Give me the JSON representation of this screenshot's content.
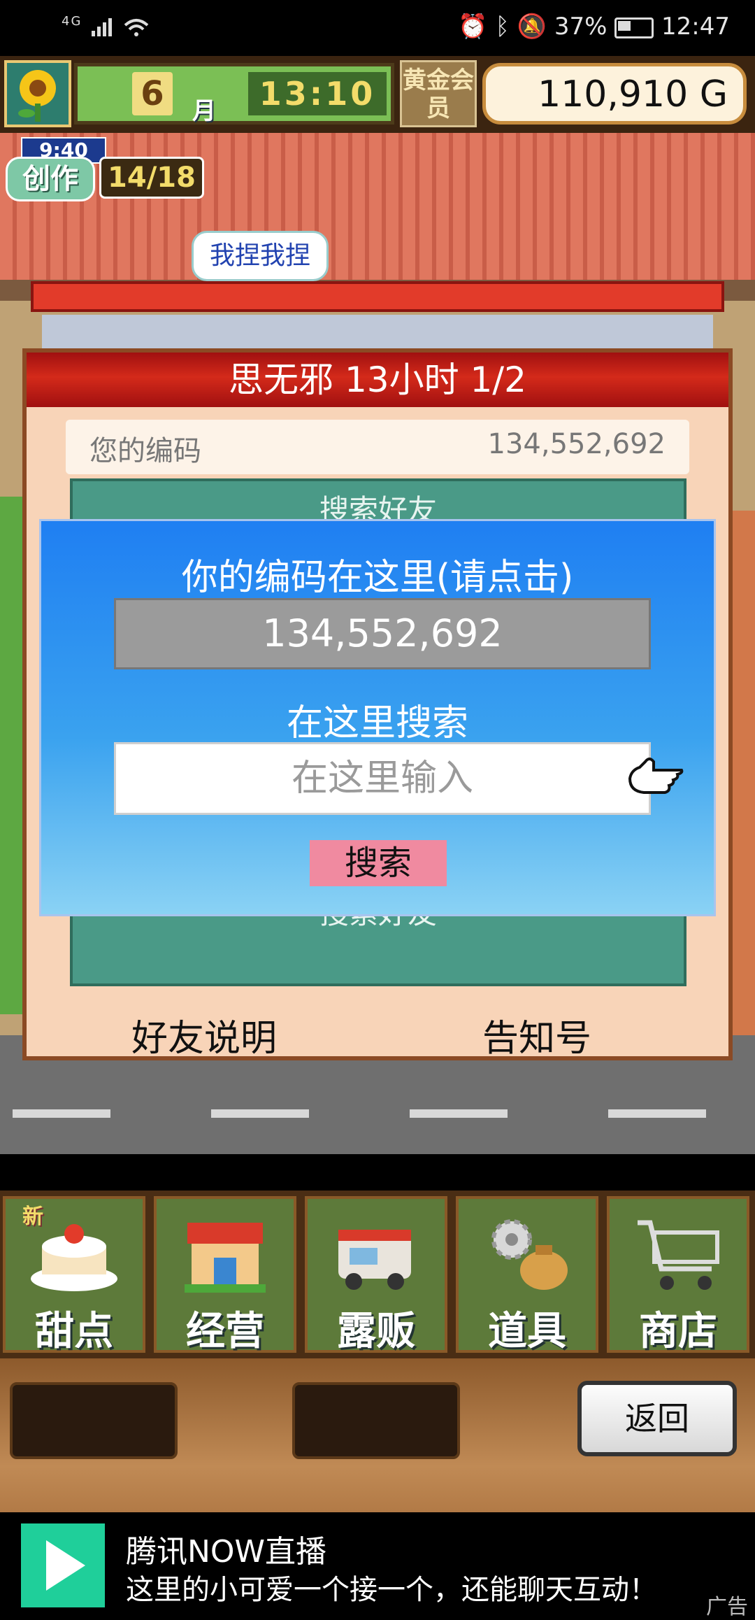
{
  "status_bar": {
    "network": "4G",
    "battery": "37%",
    "time": "12:47"
  },
  "hud": {
    "month_number": "6",
    "month_label": "月",
    "clock": "13:10",
    "vip_label": "黄金会员",
    "money": "110,910 G"
  },
  "production": {
    "timer": "9:40",
    "label": "创作",
    "count": "14/18"
  },
  "speech_bubble": "我捏我捏",
  "dialog": {
    "title": "思无邪  13小时 1/2",
    "your_code_label": "您的编码",
    "your_code_value": "134,552,692",
    "inner_top_label": "搜索好友",
    "inner_bottom_label": "搜索好友",
    "friends_help": "好友说明",
    "notice": "告知号"
  },
  "popup": {
    "title": "你的编码在这里(请点击)",
    "code": "134,552,692",
    "search_title": "在这里搜索",
    "search_placeholder": "在这里输入",
    "search_button": "搜索"
  },
  "menu": {
    "items": [
      {
        "label": "甜点",
        "icon": "cake-icon",
        "badge": "新"
      },
      {
        "label": "经营",
        "icon": "shop-icon"
      },
      {
        "label": "露贩",
        "icon": "food-truck-icon"
      },
      {
        "label": "道具",
        "icon": "gear-bag-icon"
      },
      {
        "label": "商店",
        "icon": "shopping-cart-icon"
      }
    ]
  },
  "back_button": "返回",
  "ad": {
    "title": "腾讯NOW直播",
    "text": "这里的小可爱一个接一个，还能聊天互动！",
    "tag": "广告"
  },
  "colors": {
    "dialog_title_red": "#c41e10",
    "popup_blue": "#1f7ff2",
    "search_button_pink": "#f08aa0",
    "inner_panel_teal": "#4a9a87",
    "menu_green": "#5d7a3a"
  }
}
